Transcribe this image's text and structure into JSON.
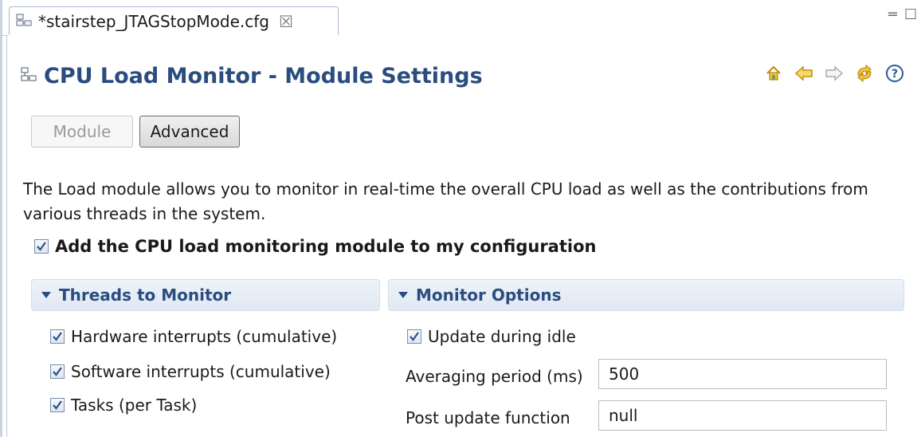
{
  "tab": {
    "title": "*stairstep_JTAGStopMode.cfg",
    "close_glyph": "☒"
  },
  "window": {
    "minimize_glyph": "═",
    "maximize_glyph": "☐"
  },
  "header": {
    "title": "CPU Load Monitor - Module Settings"
  },
  "toolbar": {
    "icons": [
      "home-icon",
      "back-arrow-icon",
      "forward-arrow-icon",
      "refresh-icon",
      "help-icon"
    ]
  },
  "buttons": {
    "module_label": "Module",
    "advanced_label": "Advanced"
  },
  "description": "The Load module allows you to monitor in real-time the overall CPU load as well as the contributions from various threads in the system.",
  "add_module": {
    "label": "Add the CPU load monitoring module to my configuration",
    "checked": true
  },
  "threads_section": {
    "title": "Threads to Monitor",
    "items": [
      {
        "label": "Hardware interrupts (cumulative)",
        "checked": true
      },
      {
        "label": "Software interrupts (cumulative)",
        "checked": true
      },
      {
        "label": "Tasks (per Task)",
        "checked": true
      }
    ]
  },
  "monitor_section": {
    "title": "Monitor Options",
    "update_idle": {
      "label": "Update during idle",
      "checked": true
    },
    "averaging": {
      "label": "Averaging period (ms)",
      "value": "500"
    },
    "post_update": {
      "label": "Post update function",
      "value": "null"
    }
  },
  "colors": {
    "heading": "#2a4d7f",
    "accent_icon": "#e0a800",
    "section_bg": "#e6edf6"
  }
}
